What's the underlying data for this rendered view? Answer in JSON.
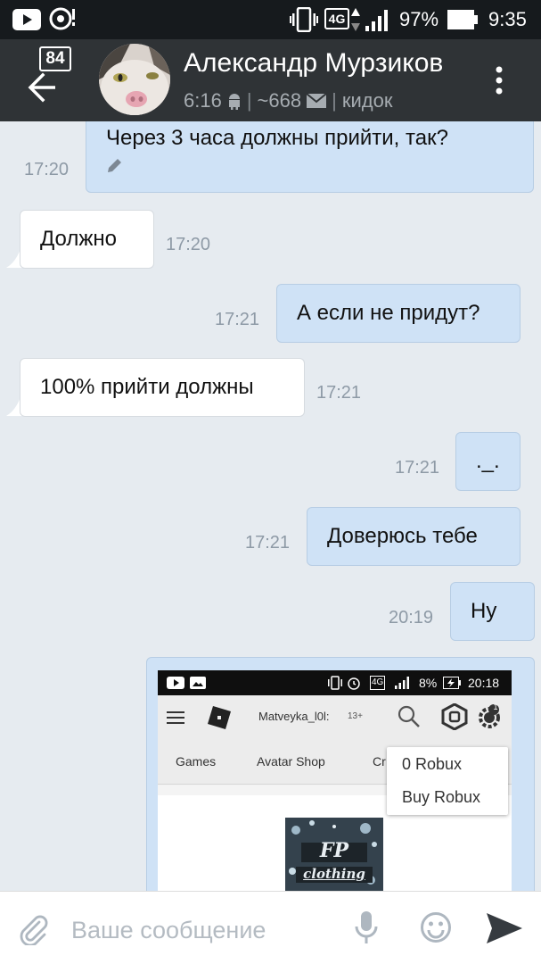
{
  "status_bar": {
    "network": "4G",
    "battery": "97%",
    "time": "9:35"
  },
  "header": {
    "unread_count": "84",
    "contact_name": "Александр Мурзиков",
    "last_seen": "6:16",
    "karma": "~668",
    "note": "кидок",
    "platform_icon": "android-icon",
    "mail_icon": "envelope-icon"
  },
  "messages": [
    {
      "direction": "out",
      "text": "Через 3 часа должны прийти, так?",
      "time": "17:20",
      "edited": true
    },
    {
      "direction": "in",
      "text": "Должно",
      "time": "17:20"
    },
    {
      "direction": "out",
      "text": "А если не придут?",
      "time": "17:21"
    },
    {
      "direction": "in",
      "text": "100% прийти должны",
      "time": "17:21"
    },
    {
      "direction": "out",
      "text": "._.",
      "time": "17:21"
    },
    {
      "direction": "out",
      "text": "Доверюсь тебе",
      "time": "17:21"
    },
    {
      "direction": "out",
      "text": "Ну",
      "time": "20:19"
    }
  ],
  "attached_screenshot": {
    "status": {
      "network": "4G",
      "battery": "8%",
      "time": "20:18"
    },
    "username": "Matveyka_l0l:",
    "age_tag": "13+",
    "notification_count": "1",
    "tabs": [
      "Games",
      "Avatar Shop",
      "Cr"
    ],
    "dropdown": [
      "0 Robux",
      "Buy Robux"
    ],
    "logo_text_top": "FP",
    "logo_text_bottom": "clothing"
  },
  "input": {
    "placeholder": "Ваше сообщение"
  },
  "colors": {
    "header_bg": "#2f3336",
    "status_bg": "#161a1d",
    "chat_bg": "#e6ebf0",
    "outgoing_bubble": "#cfe2f6",
    "incoming_bubble": "#ffffff",
    "time_text": "#8e9aa6"
  }
}
